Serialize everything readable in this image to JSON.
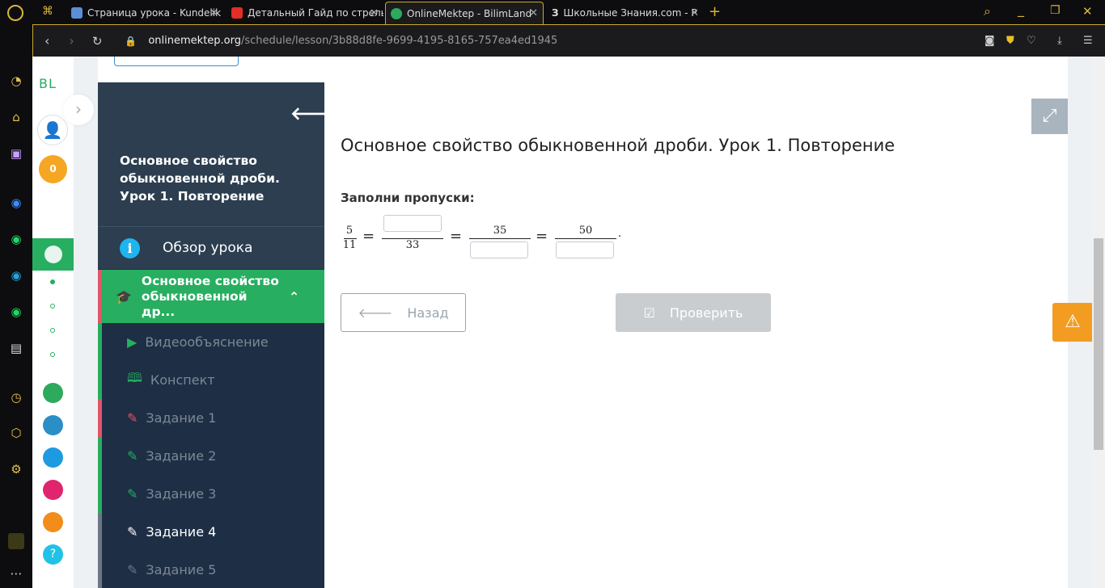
{
  "browser": {
    "tabs": [
      {
        "title": "Страница урока - Kundelik",
        "active": false,
        "color": "#5a8fd8"
      },
      {
        "title": "Детальный Гайд по стрельбе",
        "active": false,
        "color": "#e52d27"
      },
      {
        "title": "OnlineMektep - BilimLand",
        "active": true,
        "color": "#2eaa5c"
      },
      {
        "title": "Школьные Знания.com - Р",
        "active": false,
        "color": "#111"
      }
    ],
    "url_domain": "onlinemektep.org",
    "url_path": "/schedule/lesson/3b88d8fe-9699-4195-8165-757ea4ed1945"
  },
  "left_rail": {
    "logo": "BL",
    "coins": "0"
  },
  "panel": {
    "lesson_title": "Основное свойство обыкновенной дроби. Урок 1. Повторение",
    "overview": "Обзор урока",
    "section": "Основное свойство обыкновенной др...",
    "items": [
      {
        "label": "Видеообъяснение",
        "icon": "play-icon",
        "color": "#27ae60"
      },
      {
        "label": "Конспект",
        "icon": "book-icon",
        "color": "#27ae60"
      },
      {
        "label": "Задание 1",
        "icon": "edit-icon",
        "color": "#e0556a"
      },
      {
        "label": "Задание 2",
        "icon": "edit-icon",
        "color": "#27ae60"
      },
      {
        "label": "Задание 3",
        "icon": "edit-icon",
        "color": "#27ae60"
      },
      {
        "label": "Задание 4",
        "icon": "edit-icon",
        "color": "#ffffff"
      },
      {
        "label": "Задание 5",
        "icon": "edit-icon",
        "color": "#6b7785"
      }
    ]
  },
  "main": {
    "title": "Основное свойство обыкновенной дроби. Урок 1. Повторение",
    "instruction": "Заполни пропуски:",
    "equation": {
      "f1_num": "5",
      "f1_den": "11",
      "f2_den": "33",
      "f3_num": "35",
      "f4_num": "50",
      "eq": "=",
      "end": "."
    },
    "back_label": "Назад",
    "check_label": "Проверить"
  }
}
